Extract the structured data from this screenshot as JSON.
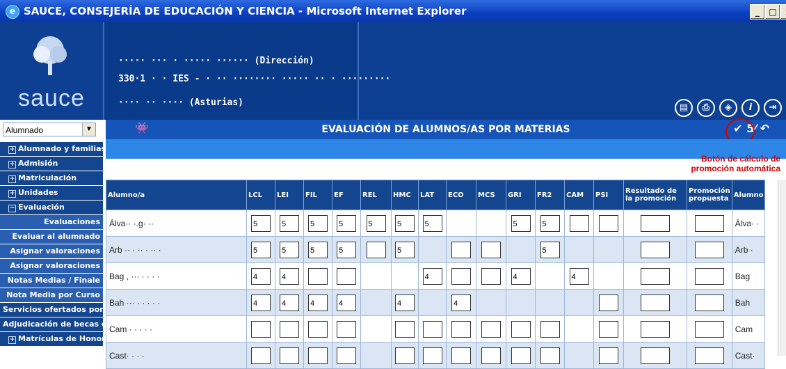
{
  "window": {
    "title": "SAUCE, CONSEJERÍA DE EDUCACIÓN Y CIENCIA - Microsoft Internet Explorer",
    "controls": [
      "_",
      "□",
      "x"
    ]
  },
  "header": {
    "logo_text": "sauce",
    "org_line1": "·····  ···  ·  ····· ······  (Dirección)",
    "org_line2": "330·1  ·  ·  IES  -  ·  ··  ········  ·····  ··  ·  ·········",
    "org_line3": "····  ··  ····  (Asturias)",
    "icons": [
      "document-icon",
      "print-icon",
      "navigate-icon",
      "info-icon",
      "exit-icon"
    ]
  },
  "nav": {
    "select_value": "Alumnado",
    "items": [
      {
        "label": "Alumnado y familias",
        "type": "closed"
      },
      {
        "label": "Admisión",
        "type": "closed"
      },
      {
        "label": "Matriculación",
        "type": "closed"
      },
      {
        "label": "Unidades",
        "type": "closed"
      },
      {
        "label": "Evaluación",
        "type": "open"
      },
      {
        "label": "Evaluaciones",
        "type": "sub"
      },
      {
        "label": "Evaluar al alumnado",
        "type": "sub"
      },
      {
        "label": "Asignar valoraciones",
        "type": "sub"
      },
      {
        "label": "Asignar valoraciones",
        "type": "sub"
      },
      {
        "label": "Notas Medias / Finale",
        "type": "sub"
      },
      {
        "label": "Nota Media por Curso",
        "type": "sub"
      },
      {
        "label": "Servicios ofertados por el",
        "type": "flush"
      },
      {
        "label": "Adjudicación de becas del",
        "type": "flush"
      },
      {
        "label": "Matrículas de Honor",
        "type": "closed"
      }
    ]
  },
  "toolbar": {
    "title": "EVALUACIÓN DE ALUMNOS/AS POR MATERIAS",
    "tools": "✔ 5⁄ ↶"
  },
  "annotation": {
    "line1": "Botón de cálculo de",
    "line2": "promoción automática"
  },
  "table": {
    "headers": [
      "Alumno/a",
      "LCL",
      "LEI",
      "FIL",
      "EF",
      "REL",
      "HMC",
      "LAT",
      "ECO",
      "MCS",
      "GRI",
      "FR2",
      "CAM",
      "PSI",
      "Resultado de la promoción",
      "Promoción propuesta",
      "Alumno"
    ],
    "rows": [
      {
        "name": "Álva·· ·.g·   ··",
        "tail": "Álva· ·",
        "cells": [
          "5",
          "5",
          "5",
          "5",
          "5",
          "5",
          "5",
          null,
          null,
          "5",
          "5",
          "",
          "",
          "",
          ""
        ]
      },
      {
        "name": "Arb   ·· ·   ·· ·  ··   ·",
        "tail": "Arb   ·",
        "cells": [
          "5",
          "5",
          "5",
          "5",
          "",
          "5",
          null,
          "",
          "",
          null,
          "5",
          null,
          null,
          "",
          ""
        ]
      },
      {
        "name": "Bag     ,   ··· ·  · · ·",
        "tail": "Bag",
        "cells": [
          "4",
          "4",
          "",
          "",
          null,
          null,
          "4",
          "",
          "",
          "4",
          null,
          "4",
          null,
          "",
          ""
        ]
      },
      {
        "name": "Bah     ···  · ·  ·  ·  ·",
        "tail": "Bah",
        "cells": [
          "4",
          "4",
          "4",
          "4",
          null,
          "4",
          null,
          "4",
          null,
          null,
          null,
          null,
          "",
          "",
          ""
        ]
      },
      {
        "name": "Cam  ·  ·       ·  ·  ·",
        "tail": "Cam",
        "cells": [
          "",
          "",
          "",
          "",
          null,
          "",
          "",
          "",
          "",
          "",
          "",
          null,
          "",
          "",
          ""
        ]
      },
      {
        "name": "Cast·   ·   ·  ·",
        "tail": "Cast·",
        "cells": [
          "",
          "",
          "",
          "",
          null,
          "",
          "",
          "",
          "",
          "",
          "",
          null,
          "",
          "",
          ""
        ]
      }
    ]
  }
}
